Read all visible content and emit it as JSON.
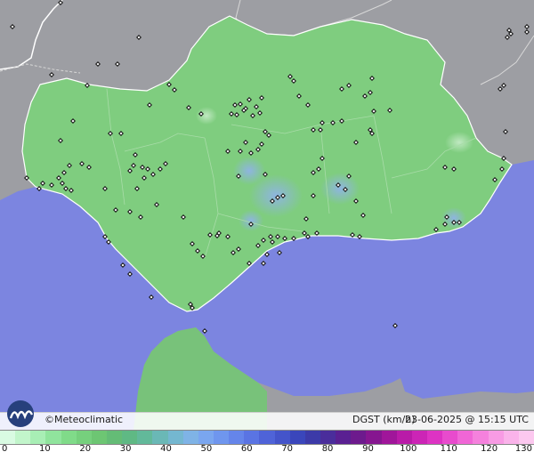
{
  "map": {
    "colors": {
      "sea": "#7c85e0",
      "land_outside": "#9d9ea3",
      "region_fill": "#7fcd7f",
      "africa_fill": "#78c27a",
      "gust_highlight": "#8fb3e6",
      "station_marker": "#111111",
      "border_line": "#ffffff"
    },
    "station_marker_icon": "diamond-marker-icon"
  },
  "footer": {
    "logo_icon": "meteoclimatic-logo-icon",
    "credit": "©Meteoclimatic",
    "legend_title": "DGST (km/h)",
    "timestamp": "23-06-2025 @ 15:15 UTC"
  },
  "colorbar": {
    "min": 0,
    "max": 130,
    "colors": [
      "#d9fbe2",
      "#c2f5cb",
      "#a8eeb5",
      "#90e49d",
      "#80db89",
      "#76d07d",
      "#6dc673",
      "#64bc76",
      "#5fb984",
      "#62b99a",
      "#6ab8b6",
      "#74b7d0",
      "#7fb3e6",
      "#7aa6ef",
      "#6f96ee",
      "#6585ea",
      "#5a74e3",
      "#4f63d8",
      "#4454ca",
      "#3a46bb",
      "#3c3aa8",
      "#4a2d9b",
      "#5a2092",
      "#6d1a8d",
      "#861690",
      "#a0169a",
      "#b91ba8",
      "#cc25b6",
      "#dd33c3",
      "#e84bcd",
      "#f066d6",
      "#f581dd",
      "#f89be4",
      "#fab3ea",
      "#fcc8ef"
    ],
    "ticks": [
      "0",
      "10",
      "20",
      "30",
      "40",
      "50",
      "60",
      "70",
      "80",
      "90",
      "100",
      "110",
      "120",
      "130"
    ]
  }
}
